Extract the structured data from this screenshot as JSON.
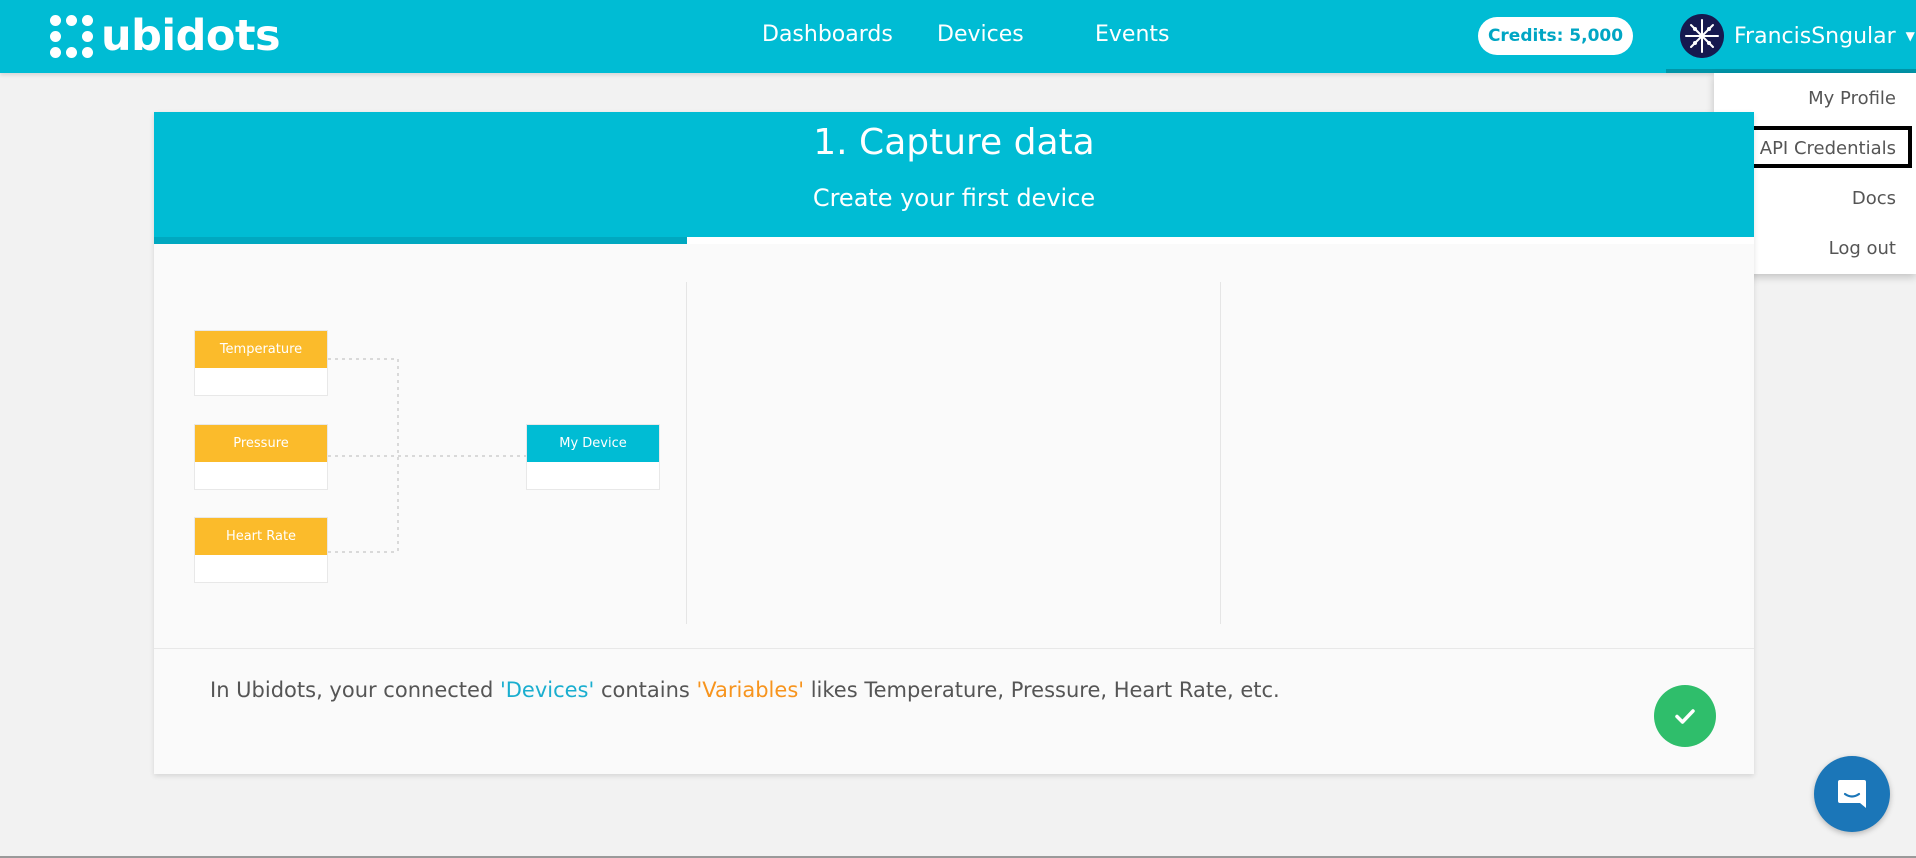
{
  "header": {
    "logo_text": "ubidots",
    "nav": [
      "Dashboards",
      "Devices",
      "Events"
    ],
    "credits": "Credits: 5,000",
    "username": "FrancisSngular"
  },
  "user_menu": {
    "items": [
      "My Profile",
      "API Credentials",
      "Docs",
      "Log out"
    ],
    "focused_item": "API Credentials"
  },
  "onboarding": {
    "title": "1. Capture data",
    "subtitle": "Create your first device",
    "progress_fraction": 0.333,
    "diagram": {
      "variables": [
        "Temperature",
        "Pressure",
        "Heart Rate"
      ],
      "device": "My Device"
    },
    "description": {
      "part1": "In Ubidots, your connected ",
      "devices": "'Devices'",
      "part2": " contains ",
      "variables": "'Variables'",
      "part3": " likes Temperature, Pressure, Heart Rate, etc."
    }
  },
  "colors": {
    "brand": "#00bcd4",
    "variable_node": "#fbbb2b",
    "success": "#2fbe6b",
    "chat": "#1b76b8"
  },
  "icons": {
    "check": "check-icon",
    "chat": "chat-icon",
    "caret": "caret-down-icon"
  }
}
